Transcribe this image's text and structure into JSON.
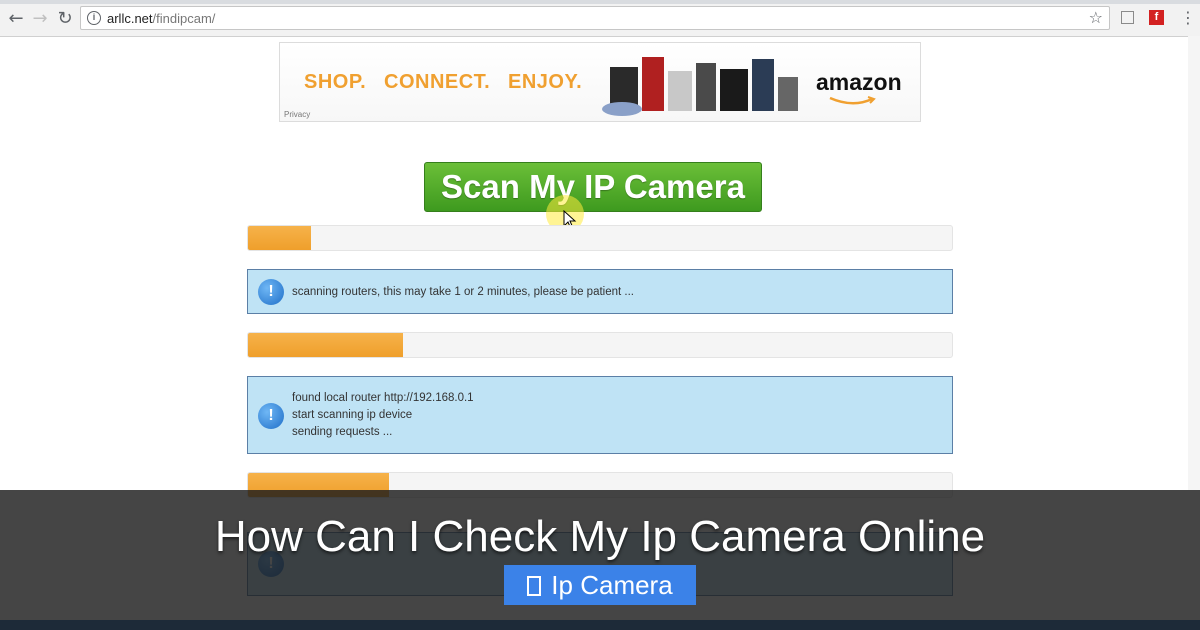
{
  "browser": {
    "url_domain": "arllc.net",
    "url_path": "/findipcam/"
  },
  "ad": {
    "words": [
      "SHOP.",
      "CONNECT.",
      "ENJOY."
    ],
    "brand": "amazon",
    "privacy": "Privacy"
  },
  "scan_button": {
    "label": "Scan My IP Camera"
  },
  "progress": [
    {
      "fraction": 0.09
    },
    {
      "fraction": 0.22
    },
    {
      "fraction": 0.2
    }
  ],
  "alerts": [
    {
      "lines": [
        "scanning routers, this may take 1 or 2 minutes, please be patient ..."
      ]
    },
    {
      "lines": [
        "found local router http://192.168.0.1",
        "start scanning ip device",
        "sending requests ..."
      ]
    }
  ],
  "overlay": {
    "title": "How Can I Check My Ip Camera Online",
    "tag": "Ip Camera"
  },
  "colors": {
    "progress_fill": "#ef9f2b",
    "alert_bg": "#bfe3f5",
    "button_green": "#4ea82a",
    "tag_blue": "#3b82e8"
  }
}
